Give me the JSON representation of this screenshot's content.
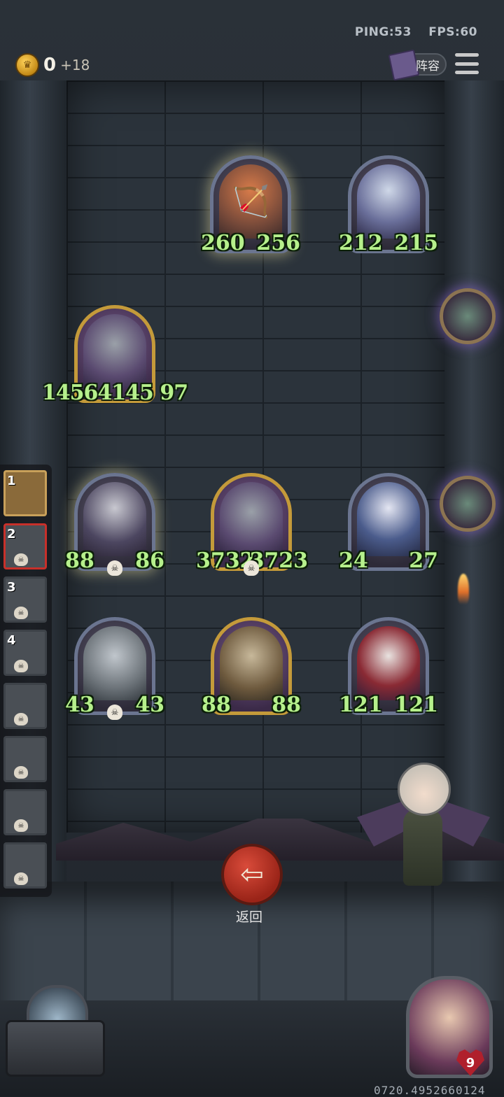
{
  "status": {
    "ping": "PING:53",
    "fps": "FPS:60"
  },
  "currency": {
    "value": "0",
    "income": "+18"
  },
  "lineup_button": {
    "label": "阵容"
  },
  "board": {
    "row1": [
      {
        "id": "archer",
        "atk": "260",
        "hp": "256"
      },
      {
        "id": "sorceress",
        "atk": "212",
        "hp": "215"
      }
    ],
    "row2": [
      {
        "id": "shark-mech",
        "stats": "14564145 97"
      }
    ],
    "row3": [
      {
        "id": "horned-elf",
        "atk": "88",
        "hp": "86"
      },
      {
        "id": "shark-mech-2",
        "atk": "3732",
        "hp": "3723"
      },
      {
        "id": "jester-elf",
        "atk": "24",
        "hp": "27"
      }
    ],
    "row4": [
      {
        "id": "robot",
        "atk": "43",
        "hp": "43"
      },
      {
        "id": "blimp",
        "atk": "88",
        "hp": "88"
      },
      {
        "id": "clown",
        "atk": "121",
        "hp": "121"
      }
    ]
  },
  "roster": [
    {
      "num": "1"
    },
    {
      "num": "2"
    },
    {
      "num": "3"
    },
    {
      "num": "4"
    },
    {
      "num": ""
    },
    {
      "num": ""
    },
    {
      "num": ""
    },
    {
      "num": ""
    }
  ],
  "back_button": {
    "label": "返回"
  },
  "player": {
    "lives": "9"
  },
  "build_id": "0720.4952660124"
}
